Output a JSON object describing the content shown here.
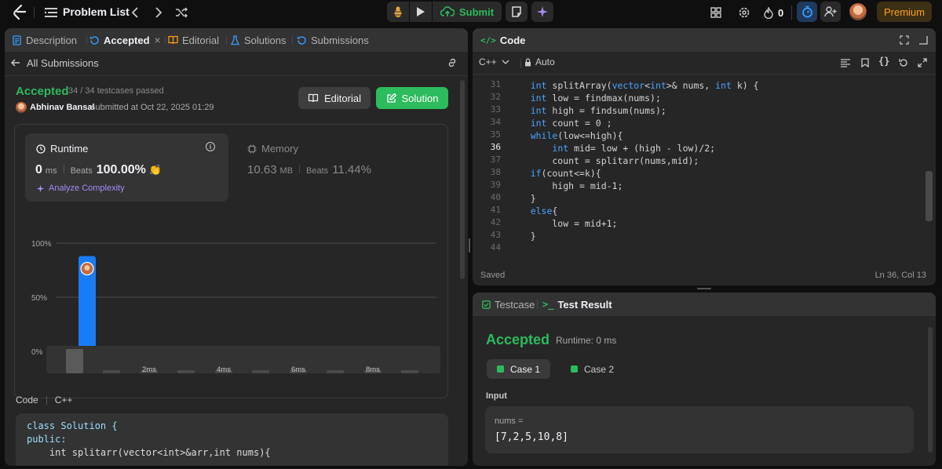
{
  "topbar": {
    "problem_list": "Problem List",
    "submit": "Submit",
    "streak": "0",
    "premium": "Premium"
  },
  "left_tabs": {
    "description": "Description",
    "accepted": "Accepted",
    "editorial": "Editorial",
    "solutions": "Solutions",
    "submissions": "Submissions"
  },
  "submission": {
    "back_label": "All Submissions",
    "status": "Accepted",
    "passed": "34 / 34 testcases passed",
    "author": "Abhinav Bansal",
    "submitted_at": "submitted at Oct 22, 2025 01:29",
    "editorial_btn": "Editorial",
    "solution_btn": "Solution"
  },
  "runtime": {
    "title": "Runtime",
    "value": "0",
    "unit": "ms",
    "beats_label": "Beats",
    "beats": "100.00%",
    "analyze": "Analyze Complexity"
  },
  "memory": {
    "title": "Memory",
    "value": "10.63",
    "unit": "MB",
    "beats_label": "Beats",
    "beats": "11.44%"
  },
  "chart_data": {
    "type": "bar",
    "y_ticks": [
      "100%",
      "50%",
      "0%"
    ],
    "x_ticks": [
      "2ms",
      "4ms",
      "6ms",
      "8ms"
    ],
    "ylim": [
      0,
      100
    ],
    "values": [
      88,
      2,
      2,
      2,
      2,
      2,
      2,
      2,
      2,
      2
    ],
    "highlight_index": 0,
    "mini_x_ticks": [
      "2ms",
      "4ms",
      "6ms",
      "8ms"
    ],
    "colors": {
      "bar": "#1a7cf5"
    }
  },
  "code_section": {
    "label": "Code",
    "lang": "C++",
    "lines": [
      "class Solution {",
      "public:",
      "    int splitarr(vector<int>&arr,int nums){"
    ]
  },
  "editor": {
    "title": "Code",
    "lang": "C++",
    "mode": "Auto",
    "status": "Saved",
    "cursor": "Ln 36, Col 13",
    "lines": [
      {
        "n": "31",
        "t": "    int splitArray(vector<int>& nums, int k) {"
      },
      {
        "n": "32",
        "t": "    int low = findmax(nums);"
      },
      {
        "n": "33",
        "t": "    int high = findsum(nums);"
      },
      {
        "n": "34",
        "t": "    int count = 0 ;"
      },
      {
        "n": "35",
        "t": "    while(low<=high){"
      },
      {
        "n": "36",
        "t": "        int mid= low + (high - low)/2;"
      },
      {
        "n": "37",
        "t": "        count = splitarr(nums,mid);"
      },
      {
        "n": "38",
        "t": "    if(count<=k){"
      },
      {
        "n": "39",
        "t": "        high = mid-1;"
      },
      {
        "n": "40",
        "t": "    }"
      },
      {
        "n": "41",
        "t": "    else{"
      },
      {
        "n": "42",
        "t": "        low = mid+1;"
      },
      {
        "n": "43",
        "t": "    }"
      },
      {
        "n": "44",
        "t": ""
      }
    ]
  },
  "result": {
    "tab_testcase": "Testcase",
    "tab_result": "Test Result",
    "status": "Accepted",
    "runtime": "Runtime: 0 ms",
    "case1": "Case 1",
    "case2": "Case 2",
    "input_label": "Input",
    "var_name": "nums =",
    "var_value": "[7,2,5,10,8]"
  }
}
